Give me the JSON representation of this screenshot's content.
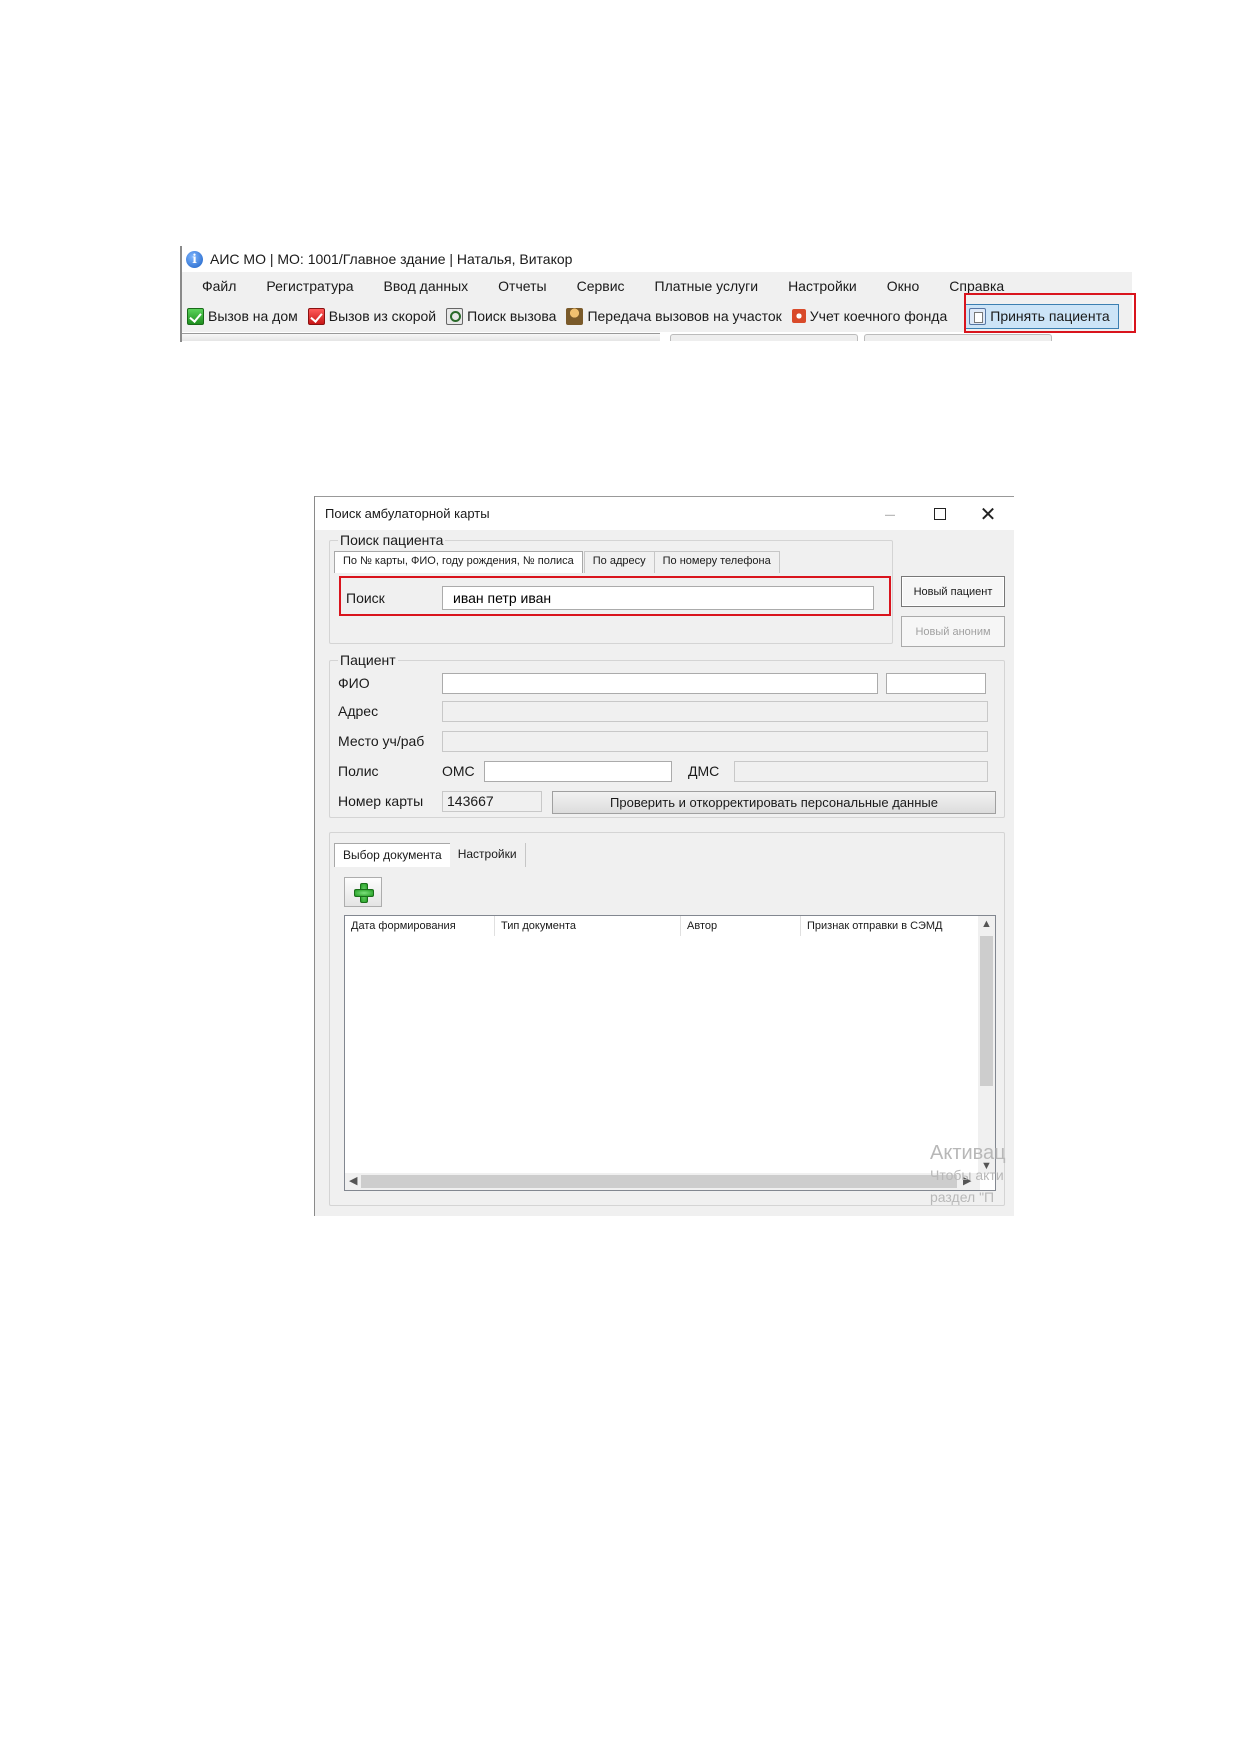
{
  "main_window": {
    "title": "АИС МО | МО: 1001/Главное здание | Наталья, Витакор",
    "menu": [
      "Файл",
      "Регистратура",
      "Ввод данных",
      "Отчеты",
      "Сервис",
      "Платные услуги",
      "Настройки",
      "Окно",
      "Справка"
    ],
    "toolbar": {
      "home_call": "Вызов на дом",
      "ambulance_call": "Вызов из скорой",
      "call_search": "Поиск вызова",
      "transfer_calls": "Передача вызовов на участок",
      "bed_fund": "Учет коечного фонда",
      "accept_patient": "Принять пациента"
    },
    "colors": {
      "highlight": "#d9141d",
      "selected_button": "#cce4f7"
    }
  },
  "dialog": {
    "title": "Поиск амбулаторной карты",
    "search_group": {
      "title": "Поиск пациента",
      "tabs": [
        "По № карты, ФИО, году рождения, № полиса",
        "По адресу",
        "По номеру телефона"
      ],
      "active_tab": 0,
      "search_label": "Поиск",
      "search_value": "иван петр иван"
    },
    "buttons": {
      "new_patient": "Новый пациент",
      "new_anonymous": "Новый аноним"
    },
    "patient_group": {
      "title": "Пациент",
      "fio_label": "ФИО",
      "address_label": "Адрес",
      "place_label": "Место уч/раб",
      "policy_label": "Полис",
      "oms_label": "ОМС",
      "dms_label": "ДМС",
      "card_number_label": "Номер карты",
      "card_number": "143667",
      "verify_button": "Проверить и откорректировать персональные данные"
    },
    "documents": {
      "tabs": [
        "Выбор документа",
        "Настройки"
      ],
      "active_tab": 0,
      "columns": [
        "Дата формирования",
        "Тип документа",
        "Автор",
        "Признак отправки в СЭМД"
      ],
      "rows": []
    },
    "watermark": {
      "line1": "Активац",
      "line2": "Чтобы акти",
      "line3": "раздел \"П"
    }
  }
}
